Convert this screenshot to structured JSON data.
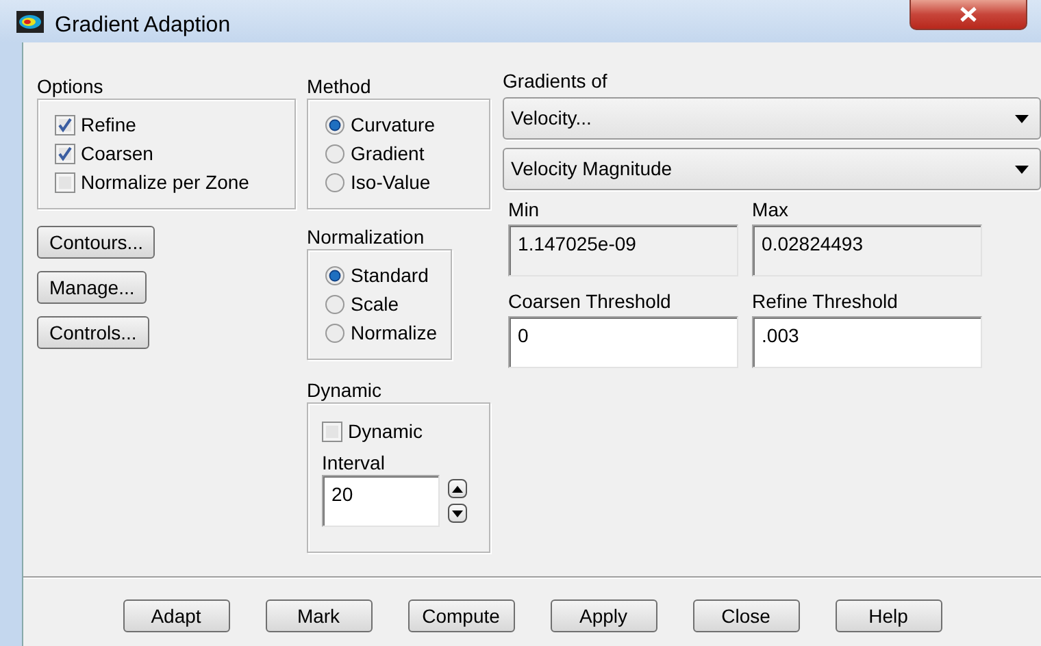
{
  "window": {
    "title": "Gradient Adaption"
  },
  "options": {
    "label": "Options",
    "items": [
      {
        "label": "Refine",
        "checked": true
      },
      {
        "label": "Coarsen",
        "checked": true
      },
      {
        "label": "Normalize per Zone",
        "checked": false
      }
    ]
  },
  "side_buttons": [
    "Contours...",
    "Manage...",
    "Controls..."
  ],
  "method": {
    "label": "Method",
    "items": [
      {
        "label": "Curvature",
        "selected": true
      },
      {
        "label": "Gradient",
        "selected": false
      },
      {
        "label": "Iso-Value",
        "selected": false
      }
    ]
  },
  "normalization": {
    "label": "Normalization",
    "items": [
      {
        "label": "Standard",
        "selected": true
      },
      {
        "label": "Scale",
        "selected": false
      },
      {
        "label": "Normalize",
        "selected": false
      }
    ]
  },
  "dynamic": {
    "label": "Dynamic",
    "checkbox": {
      "label": "Dynamic",
      "checked": false
    },
    "interval": {
      "label": "Interval",
      "value": "20"
    }
  },
  "gradients_of": {
    "label": "Gradients of",
    "dropdowns": [
      "Velocity...",
      "Velocity Magnitude"
    ]
  },
  "fields": [
    {
      "label": "Min",
      "value": "1.147025e-09",
      "readonly": true
    },
    {
      "label": "Max",
      "value": "0.02824493",
      "readonly": true
    },
    {
      "label": "Coarsen Threshold",
      "value": "0",
      "readonly": false
    },
    {
      "label": "Refine Threshold",
      "value": ".003",
      "readonly": false
    }
  ],
  "buttons": [
    "Adapt",
    "Mark",
    "Compute",
    "Apply",
    "Close",
    "Help"
  ]
}
